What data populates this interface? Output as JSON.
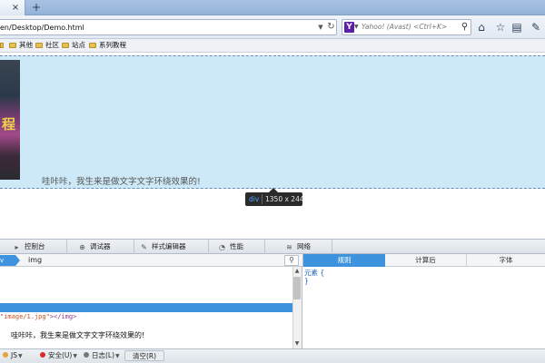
{
  "browser": {
    "tab": {
      "close": "×"
    },
    "new_tab": "+",
    "url": "en/Desktop/Demo.html",
    "search": {
      "engine_icon": "Y",
      "placeholder": "Yahoo! (Avast) <Ctrl+K>"
    }
  },
  "bookmarks": [
    {
      "label": "其他"
    },
    {
      "label": "社区"
    },
    {
      "label": "站点"
    },
    {
      "label": "系列教程"
    }
  ],
  "page": {
    "text": "哇咔咔，我生来是做文字文字环绕效果的!",
    "book_cover_title": "程"
  },
  "tooltip": {
    "tag": "div",
    "dims": "1350 x 244"
  },
  "devtools": {
    "tabs": [
      {
        "label": "控制台",
        "icon": "console-icon"
      },
      {
        "label": "调试器",
        "icon": "debugger-icon"
      },
      {
        "label": "样式编辑器",
        "icon": "style-editor-icon"
      },
      {
        "label": "性能",
        "icon": "performance-icon"
      },
      {
        "label": "网络",
        "icon": "network-icon"
      }
    ],
    "breadcrumb": [
      {
        "label": "v"
      },
      {
        "label": "img"
      }
    ],
    "markup": {
      "line1_attr": "\"image/1.jpg\"",
      "line1_tail": "></img>",
      "line2": "哇咔咔，我生来是做文字文字环绕效果的!"
    },
    "sidebar_tabs": [
      {
        "label": "规则"
      },
      {
        "label": "计算后"
      },
      {
        "label": "字体"
      }
    ],
    "rules": {
      "selector": "元素 {",
      "close": "}"
    },
    "console": {
      "items": [
        {
          "label": "JS"
        },
        {
          "label": "安全(U)"
        },
        {
          "label": "日志(L)"
        }
      ],
      "clear": "清空(R)"
    }
  },
  "colors": {
    "highlight": "#cde9f7",
    "accent": "#3d93dd",
    "tooltip": "#2b2b2b"
  }
}
